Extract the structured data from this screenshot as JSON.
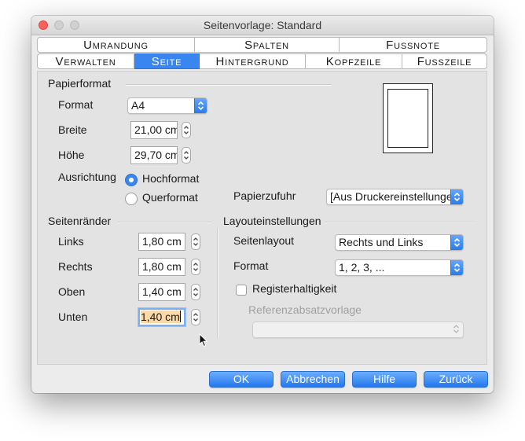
{
  "window": {
    "title": "Seitenvorlage: Standard"
  },
  "tabs": {
    "row1": [
      "Umrandung",
      "Spalten",
      "Fussnote"
    ],
    "row2": [
      "Verwalten",
      "Seite",
      "Hintergrund",
      "Kopfzeile",
      "Fusszeile"
    ],
    "active": "Seite"
  },
  "paper": {
    "heading": "Papierformat",
    "format_label": "Format",
    "format_value": "A4",
    "width_label": "Breite",
    "width_value": "21,00 cm",
    "height_label": "Höhe",
    "height_value": "29,70 cm",
    "orientation_label": "Ausrichtung",
    "portrait_label": "Hochformat",
    "landscape_label": "Querformat",
    "orientation_selected": "Hochformat",
    "tray_label": "Papierzufuhr",
    "tray_value": "[Aus Druckereinstellungen]"
  },
  "margins": {
    "heading": "Seitenränder",
    "left_label": "Links",
    "left_value": "1,80 cm",
    "right_label": "Rechts",
    "right_value": "1,80 cm",
    "top_label": "Oben",
    "top_value": "1,40 cm",
    "bottom_label": "Unten",
    "bottom_value": "1,40 cm"
  },
  "layout": {
    "heading": "Layouteinstellungen",
    "page_layout_label": "Seitenlayout",
    "page_layout_value": "Rechts und Links",
    "format_label": "Format",
    "format_value": "1, 2, 3, ...",
    "register_label": "Registerhaltigkeit",
    "register_checked": false,
    "ref_style_label": "Referenzabsatzvorlage",
    "ref_style_value": ""
  },
  "buttons": {
    "ok": "OK",
    "cancel": "Abbrechen",
    "help": "Hilfe",
    "reset": "Zurück"
  },
  "colors": {
    "accent": "#3a86f0",
    "focus_highlight": "#fad9a8"
  }
}
